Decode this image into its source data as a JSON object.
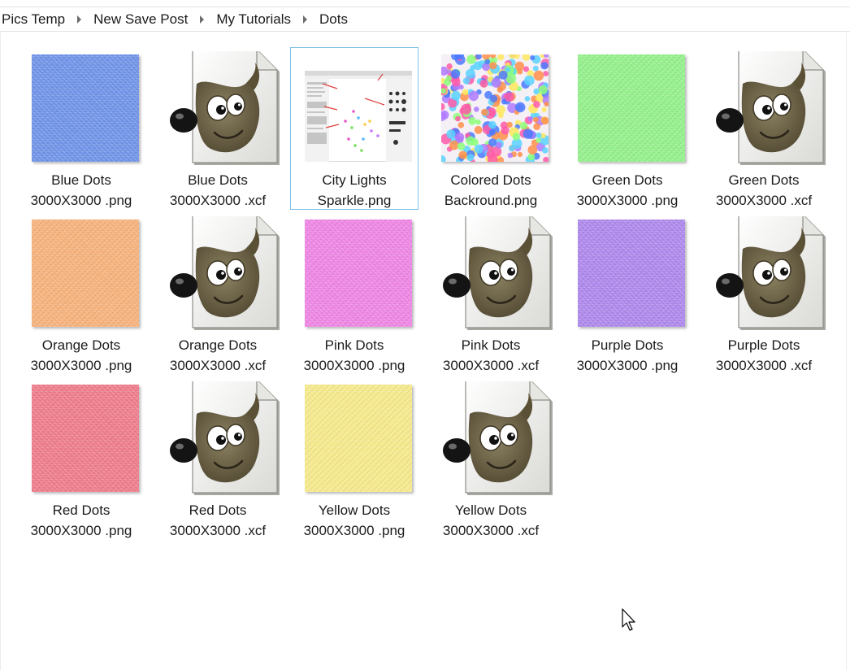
{
  "breadcrumb": {
    "items": [
      "Pics Temp",
      "New Save Post",
      "My Tutorials",
      "Dots"
    ]
  },
  "files": [
    {
      "line1": "Blue Dots",
      "line2": "3000X3000 .png",
      "kind": "png",
      "color": "#6f93e8"
    },
    {
      "line1": "Blue Dots",
      "line2": "3000X3000 .xcf",
      "kind": "xcf",
      "color": ""
    },
    {
      "line1": "City Lights",
      "line2": "Sparkle.png",
      "kind": "screenshot",
      "color": "",
      "selected": true
    },
    {
      "line1": "Colored Dots",
      "line2": "Backround.png",
      "kind": "confetti",
      "color": ""
    },
    {
      "line1": "Green Dots",
      "line2": "3000X3000 .png",
      "kind": "png",
      "color": "#93f08a"
    },
    {
      "line1": "Green Dots",
      "line2": "3000X3000 .xcf",
      "kind": "xcf",
      "color": ""
    },
    {
      "line1": "Orange Dots",
      "line2": "3000X3000 .png",
      "kind": "png",
      "color": "#f6b17a"
    },
    {
      "line1": "Orange Dots",
      "line2": "3000X3000 .xcf",
      "kind": "xcf",
      "color": ""
    },
    {
      "line1": "Pink Dots",
      "line2": "3000X3000 .png",
      "kind": "png",
      "color": "#ee84e4"
    },
    {
      "line1": "Pink Dots",
      "line2": "3000X3000 .xcf",
      "kind": "xcf",
      "color": ""
    },
    {
      "line1": "Purple Dots",
      "line2": "3000X3000 .png",
      "kind": "png",
      "color": "#ad87ec"
    },
    {
      "line1": "Purple Dots",
      "line2": "3000X3000 .xcf",
      "kind": "xcf",
      "color": ""
    },
    {
      "line1": "Red Dots",
      "line2": "3000X3000 .png",
      "kind": "png",
      "color": "#ee7b8a"
    },
    {
      "line1": "Red Dots",
      "line2": "3000X3000 .xcf",
      "kind": "xcf",
      "color": ""
    },
    {
      "line1": "Yellow Dots",
      "line2": "3000X3000 .png",
      "kind": "png",
      "color": "#f5e98a"
    },
    {
      "line1": "Yellow Dots",
      "line2": "3000X3000 .xcf",
      "kind": "xcf",
      "color": ""
    }
  ],
  "colors": {
    "selection_border": "#7cc0e6",
    "gimp_body": "#6b5f3f",
    "confetti": [
      "#ff5aa8",
      "#5ad2ff",
      "#ffe95a",
      "#8cff7a",
      "#b07aff",
      "#ff8f4a",
      "#4a7aff"
    ]
  },
  "icons": {
    "xcf": "gimp-wilber-document-icon",
    "breadcrumb_separator": "chevron-right-icon",
    "pointer": "mouse-pointer-icon"
  }
}
